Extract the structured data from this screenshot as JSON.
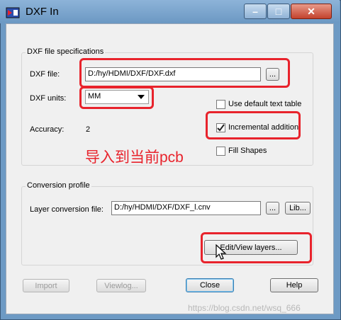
{
  "window": {
    "title": "DXF In"
  },
  "spec_group": {
    "title": "DXF file specifications",
    "dxf_file_label": "DXF file:",
    "dxf_file_value": "D:/hy/HDMI/DXF/DXF.dxf",
    "browse_label": "...",
    "units_label": "DXF units:",
    "units_value": "MM",
    "accuracy_label": "Accuracy:",
    "accuracy_value": "2",
    "use_default_text_table": "Use default text table",
    "incremental_addition": "Incremental addition",
    "fill_shapes": "Fill Shapes"
  },
  "annotation": "导入到当前pcb",
  "profile_group": {
    "title": "Conversion profile",
    "layer_file_label": "Layer conversion file:",
    "layer_file_value": "D:/hy/HDMI/DXF/DXF_l.cnv",
    "browse_label": "...",
    "lib_label": "Lib...",
    "edit_layers_label": "Edit/View layers..."
  },
  "buttons": {
    "import": "Import",
    "viewlog": "Viewlog...",
    "close": "Close",
    "help": "Help"
  },
  "watermark": "https://blog.csdn.net/wsq_666"
}
